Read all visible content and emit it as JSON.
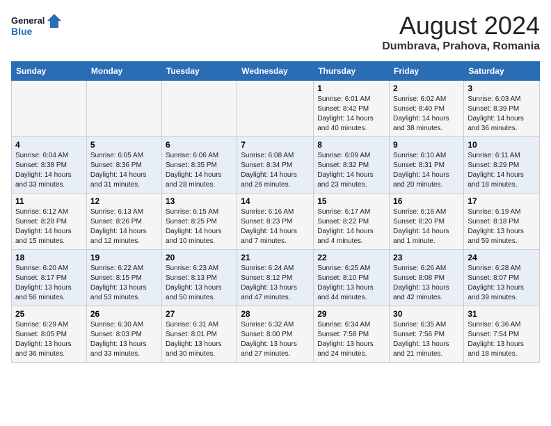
{
  "logo": {
    "line1": "General",
    "line2": "Blue"
  },
  "title": "August 2024",
  "subtitle": "Dumbrava, Prahova, Romania",
  "days_of_week": [
    "Sunday",
    "Monday",
    "Tuesday",
    "Wednesday",
    "Thursday",
    "Friday",
    "Saturday"
  ],
  "weeks": [
    [
      {
        "day": "",
        "info": ""
      },
      {
        "day": "",
        "info": ""
      },
      {
        "day": "",
        "info": ""
      },
      {
        "day": "",
        "info": ""
      },
      {
        "day": "1",
        "info": "Sunrise: 6:01 AM\nSunset: 8:42 PM\nDaylight: 14 hours and 40 minutes."
      },
      {
        "day": "2",
        "info": "Sunrise: 6:02 AM\nSunset: 8:40 PM\nDaylight: 14 hours and 38 minutes."
      },
      {
        "day": "3",
        "info": "Sunrise: 6:03 AM\nSunset: 8:39 PM\nDaylight: 14 hours and 36 minutes."
      }
    ],
    [
      {
        "day": "4",
        "info": "Sunrise: 6:04 AM\nSunset: 8:38 PM\nDaylight: 14 hours and 33 minutes."
      },
      {
        "day": "5",
        "info": "Sunrise: 6:05 AM\nSunset: 8:36 PM\nDaylight: 14 hours and 31 minutes."
      },
      {
        "day": "6",
        "info": "Sunrise: 6:06 AM\nSunset: 8:35 PM\nDaylight: 14 hours and 28 minutes."
      },
      {
        "day": "7",
        "info": "Sunrise: 6:08 AM\nSunset: 8:34 PM\nDaylight: 14 hours and 26 minutes."
      },
      {
        "day": "8",
        "info": "Sunrise: 6:09 AM\nSunset: 8:32 PM\nDaylight: 14 hours and 23 minutes."
      },
      {
        "day": "9",
        "info": "Sunrise: 6:10 AM\nSunset: 8:31 PM\nDaylight: 14 hours and 20 minutes."
      },
      {
        "day": "10",
        "info": "Sunrise: 6:11 AM\nSunset: 8:29 PM\nDaylight: 14 hours and 18 minutes."
      }
    ],
    [
      {
        "day": "11",
        "info": "Sunrise: 6:12 AM\nSunset: 8:28 PM\nDaylight: 14 hours and 15 minutes."
      },
      {
        "day": "12",
        "info": "Sunrise: 6:13 AM\nSunset: 8:26 PM\nDaylight: 14 hours and 12 minutes."
      },
      {
        "day": "13",
        "info": "Sunrise: 6:15 AM\nSunset: 8:25 PM\nDaylight: 14 hours and 10 minutes."
      },
      {
        "day": "14",
        "info": "Sunrise: 6:16 AM\nSunset: 8:23 PM\nDaylight: 14 hours and 7 minutes."
      },
      {
        "day": "15",
        "info": "Sunrise: 6:17 AM\nSunset: 8:22 PM\nDaylight: 14 hours and 4 minutes."
      },
      {
        "day": "16",
        "info": "Sunrise: 6:18 AM\nSunset: 8:20 PM\nDaylight: 14 hours and 1 minute."
      },
      {
        "day": "17",
        "info": "Sunrise: 6:19 AM\nSunset: 8:18 PM\nDaylight: 13 hours and 59 minutes."
      }
    ],
    [
      {
        "day": "18",
        "info": "Sunrise: 6:20 AM\nSunset: 8:17 PM\nDaylight: 13 hours and 56 minutes."
      },
      {
        "day": "19",
        "info": "Sunrise: 6:22 AM\nSunset: 8:15 PM\nDaylight: 13 hours and 53 minutes."
      },
      {
        "day": "20",
        "info": "Sunrise: 6:23 AM\nSunset: 8:13 PM\nDaylight: 13 hours and 50 minutes."
      },
      {
        "day": "21",
        "info": "Sunrise: 6:24 AM\nSunset: 8:12 PM\nDaylight: 13 hours and 47 minutes."
      },
      {
        "day": "22",
        "info": "Sunrise: 6:25 AM\nSunset: 8:10 PM\nDaylight: 13 hours and 44 minutes."
      },
      {
        "day": "23",
        "info": "Sunrise: 6:26 AM\nSunset: 8:08 PM\nDaylight: 13 hours and 42 minutes."
      },
      {
        "day": "24",
        "info": "Sunrise: 6:28 AM\nSunset: 8:07 PM\nDaylight: 13 hours and 39 minutes."
      }
    ],
    [
      {
        "day": "25",
        "info": "Sunrise: 6:29 AM\nSunset: 8:05 PM\nDaylight: 13 hours and 36 minutes."
      },
      {
        "day": "26",
        "info": "Sunrise: 6:30 AM\nSunset: 8:03 PM\nDaylight: 13 hours and 33 minutes."
      },
      {
        "day": "27",
        "info": "Sunrise: 6:31 AM\nSunset: 8:01 PM\nDaylight: 13 hours and 30 minutes."
      },
      {
        "day": "28",
        "info": "Sunrise: 6:32 AM\nSunset: 8:00 PM\nDaylight: 13 hours and 27 minutes."
      },
      {
        "day": "29",
        "info": "Sunrise: 6:34 AM\nSunset: 7:58 PM\nDaylight: 13 hours and 24 minutes."
      },
      {
        "day": "30",
        "info": "Sunrise: 6:35 AM\nSunset: 7:56 PM\nDaylight: 13 hours and 21 minutes."
      },
      {
        "day": "31",
        "info": "Sunrise: 6:36 AM\nSunset: 7:54 PM\nDaylight: 13 hours and 18 minutes."
      }
    ]
  ]
}
